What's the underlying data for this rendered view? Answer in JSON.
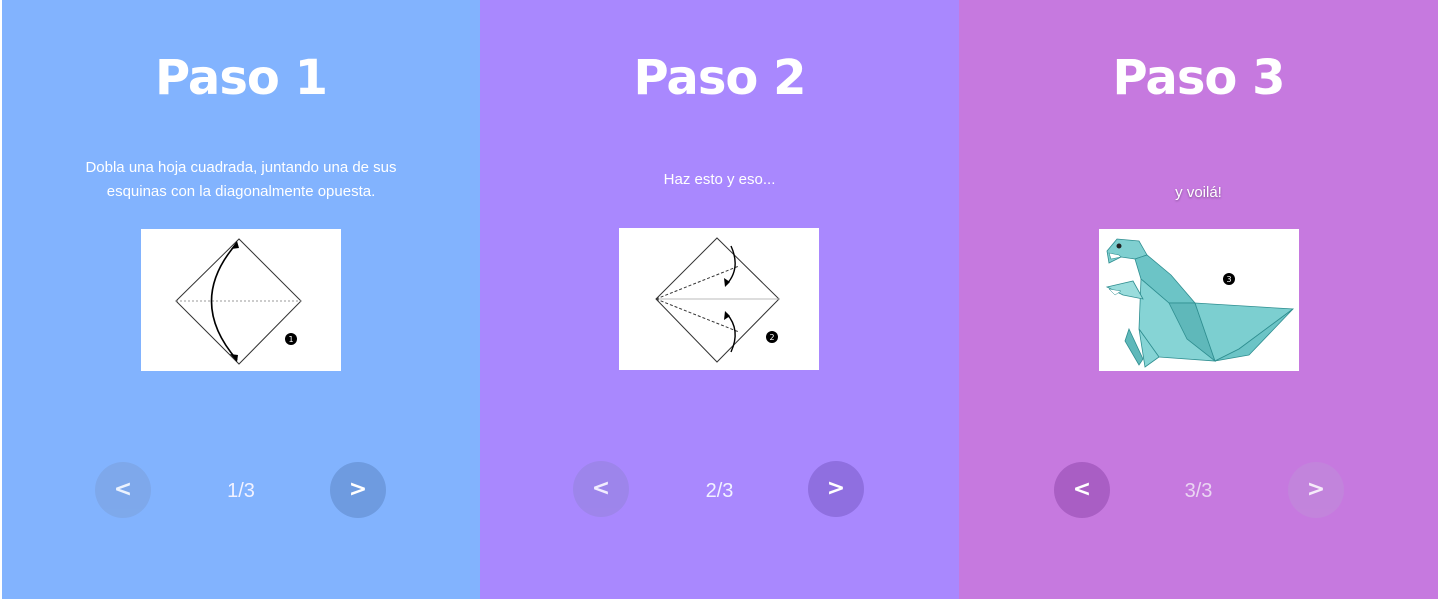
{
  "steps": [
    {
      "title": "Paso 1",
      "description": "Dobla una hoja cuadrada, juntando una de sus esquinas con la diagonalmente opuesta.",
      "counter": "1/3",
      "prev_label": "<",
      "next_label": ">",
      "step_badge": "1",
      "background": "#82b3fe"
    },
    {
      "title": "Paso 2",
      "description": "Haz esto y eso...",
      "counter": "2/3",
      "prev_label": "<",
      "next_label": ">",
      "step_badge": "2",
      "background": "#a988fe"
    },
    {
      "title": "Paso 3",
      "description": "y voilá!",
      "counter": "3/3",
      "prev_label": "<",
      "next_label": ">",
      "step_badge": "3",
      "background": "#c679df"
    }
  ],
  "illustration_icons": [
    "origami-fold-diagram-step-1",
    "origami-fold-diagram-step-2",
    "origami-dinosaur-result"
  ],
  "colors": {
    "text": "#ffffff",
    "illustration_background": "#ffffff",
    "dinosaur": "#6cc4c6"
  }
}
